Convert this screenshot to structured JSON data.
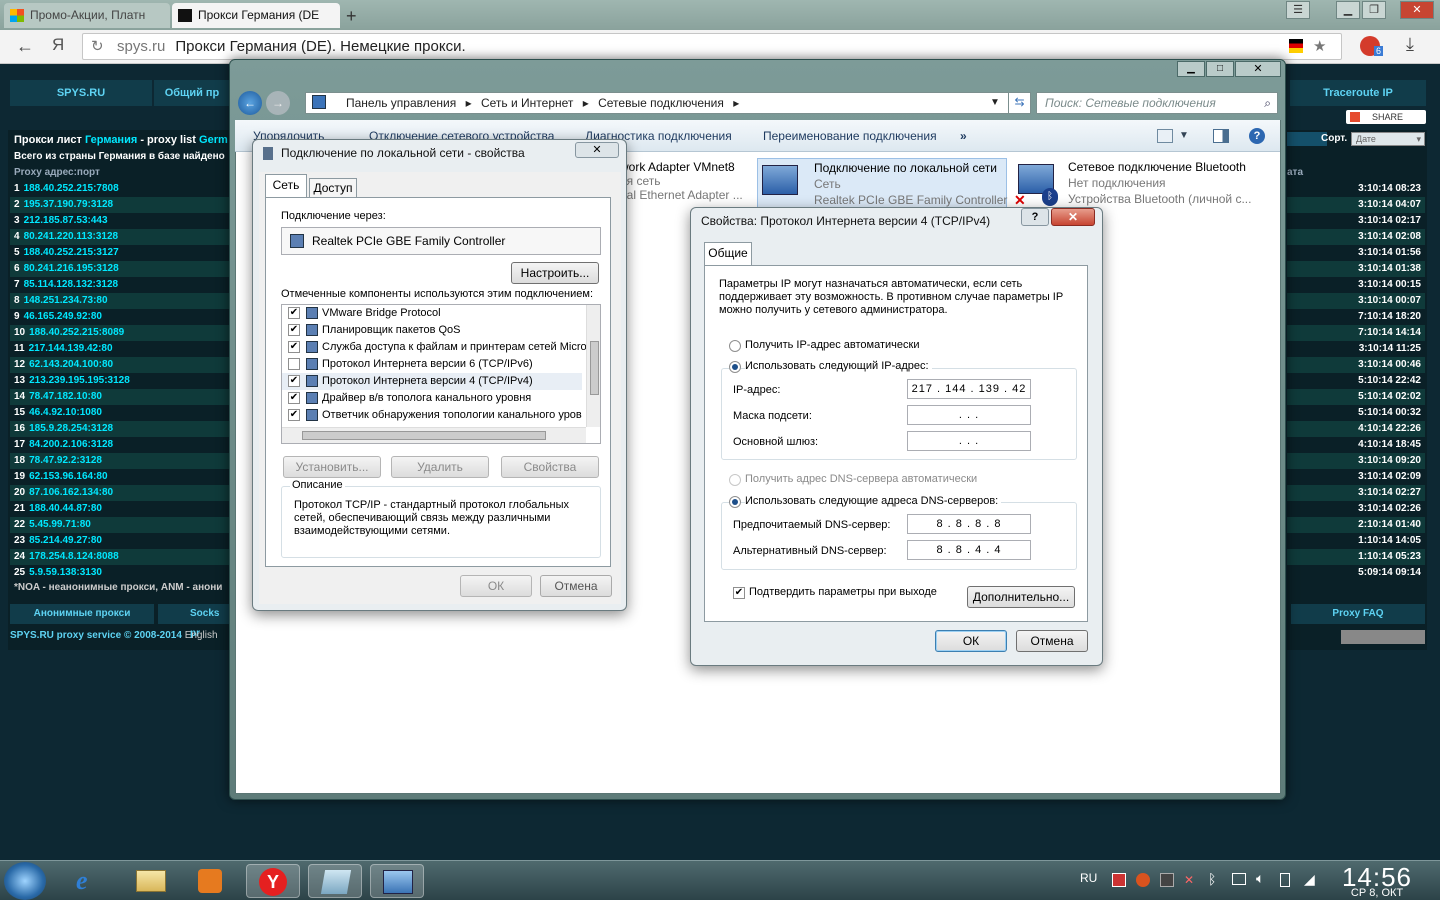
{
  "browser": {
    "tabs": [
      {
        "label": "Промо-Акции, Платн"
      },
      {
        "label": "Прокси Германия (DE"
      }
    ],
    "url_domain": "spys.ru",
    "url_title": "Прокси Германия (DE). Немецкие прокси.",
    "yandex_badge": "6"
  },
  "spys": {
    "nav": [
      "SPYS.RU",
      "Общий пр",
      "Traceroute IP"
    ],
    "share": "SHARE",
    "sort_label": "Сорт.",
    "sort_value": "Дате",
    "list_title": "Прокси лист ",
    "list_title_country": "Германия",
    "list_title_rest": " - proxy list ",
    "list_title_en": "Germ",
    "total": "Всего из страны Германия в базе найдено",
    "col_addr": "Proxy адрес:порт",
    "col_date": "ата",
    "rows": [
      {
        "n": "1",
        "ip": "188.40.252.215:7808",
        "t": "3:10:14 08:23"
      },
      {
        "n": "2",
        "ip": "195.37.190.79:3128",
        "t": "3:10:14 04:07"
      },
      {
        "n": "3",
        "ip": "212.185.87.53:443",
        "t": "3:10:14 02:17"
      },
      {
        "n": "4",
        "ip": "80.241.220.113:3128",
        "t": "3:10:14 02:08"
      },
      {
        "n": "5",
        "ip": "188.40.252.215:3127",
        "t": "3:10:14 01:56"
      },
      {
        "n": "6",
        "ip": "80.241.216.195:3128",
        "t": "3:10:14 01:38"
      },
      {
        "n": "7",
        "ip": "85.114.128.132:3128",
        "t": "3:10:14 00:15"
      },
      {
        "n": "8",
        "ip": "148.251.234.73:80",
        "t": "3:10:14 00:07"
      },
      {
        "n": "9",
        "ip": "46.165.249.92:80",
        "t": "7:10:14 18:20"
      },
      {
        "n": "10",
        "ip": "188.40.252.215:8089",
        "t": "7:10:14 14:14"
      },
      {
        "n": "11",
        "ip": "217.144.139.42:80",
        "t": "3:10:14 11:25"
      },
      {
        "n": "12",
        "ip": "62.143.204.100:80",
        "t": "3:10:14 00:46"
      },
      {
        "n": "13",
        "ip": "213.239.195.195:3128",
        "t": "5:10:14 22:42"
      },
      {
        "n": "14",
        "ip": "78.47.182.10:80",
        "t": "5:10:14 02:02"
      },
      {
        "n": "15",
        "ip": "46.4.92.10:1080",
        "t": "5:10:14 00:32"
      },
      {
        "n": "16",
        "ip": "185.9.28.254:3128",
        "t": "4:10:14 22:26"
      },
      {
        "n": "17",
        "ip": "84.200.2.106:3128",
        "t": "4:10:14 18:45"
      },
      {
        "n": "18",
        "ip": "78.47.92.2:3128",
        "t": "3:10:14 09:20"
      },
      {
        "n": "19",
        "ip": "62.153.96.164:80",
        "t": "3:10:14 02:09"
      },
      {
        "n": "20",
        "ip": "87.106.162.134:80",
        "t": "3:10:14 02:27"
      },
      {
        "n": "21",
        "ip": "188.40.44.87:80",
        "t": "3:10:14 02:26"
      },
      {
        "n": "22",
        "ip": "5.45.99.71:80",
        "t": "2:10:14 01:40"
      },
      {
        "n": "23",
        "ip": "85.214.49.27:80",
        "t": "1:10:14 14:05"
      },
      {
        "n": "24",
        "ip": "178.254.8.124:8088",
        "t": "1:10:14 05:23"
      },
      {
        "n": "25",
        "ip": "5.9.59.138:3130",
        "t": "5:09:14 09:14"
      }
    ],
    "noa": "*NOA - неанонимные прокси, ANM - анони",
    "bottom_links": [
      "Анонимные прокси",
      "Socks pr",
      "Proxy FAQ"
    ],
    "footer": "SPYS.RU proxy service © 2008-2014",
    "footer_lang": "English"
  },
  "explorer": {
    "breadcrumb": [
      "Панель управления",
      "Сетевые подключения",
      "Сеть и Интернет"
    ],
    "search_placeholder": "Поиск: Сетевые подключения",
    "commands": [
      "Упорядочить",
      "Отключение сетевого устройства",
      "Диагностика подключения",
      "Переименование подключения",
      "»"
    ],
    "adapters": [
      {
        "name": "work Adapter VMnet8",
        "status": "ая сеть",
        "device": "ual Ethernet Adapter ..."
      },
      {
        "name": "Подключение по локальной сети",
        "status": "Сеть",
        "device": "Realtek PCIe GBE Family Controller"
      },
      {
        "name": "Сетевое подключение Bluetooth",
        "status": "Нет подключения",
        "device": "Устройства Bluetooth (личной с..."
      }
    ]
  },
  "lan_dialog": {
    "title": "Подключение по локальной сети - свойства",
    "tabs": [
      "Сеть",
      "Доступ"
    ],
    "connect_via": "Подключение через:",
    "adapter": "Realtek PCIe GBE Family Controller",
    "configure": "Настроить...",
    "components_label": "Отмеченные компоненты используются этим подключением:",
    "components": [
      {
        "label": "VMware Bridge Protocol",
        "checked": "✔"
      },
      {
        "label": "Планировщик пакетов QoS",
        "checked": "✔"
      },
      {
        "label": "Служба доступа к файлам и принтерам сетей Micro",
        "checked": "✔"
      },
      {
        "label": "Протокол Интернета версии 6 (TCP/IPv6)",
        "checked": ""
      },
      {
        "label": "Протокол Интернета версии 4 (TCP/IPv4)",
        "checked": "✔"
      },
      {
        "label": "Драйвер в/в тополога канального уровня",
        "checked": "✔"
      },
      {
        "label": "Ответчик обнаружения топологии канального уров",
        "checked": "✔"
      }
    ],
    "install": "Установить...",
    "remove": "Удалить",
    "properties": "Свойства",
    "desc_title": "Описание",
    "desc": "Протокол TCP/IP - стандартный протокол глобальных сетей, обеспечивающий связь между различными взаимодействующими сетями.",
    "ok": "ОК",
    "cancel": "Отмена"
  },
  "ipv4_dialog": {
    "title": "Свойства: Протокол Интернета версии 4 (TCP/IPv4)",
    "tab": "Общие",
    "intro": "Параметры IP могут назначаться автоматически, если сеть поддерживает эту возможность. В противном случае параметры IP можно получить у сетевого администратора.",
    "auto_ip": "Получить IP-адрес автоматически",
    "manual_ip": "Использовать следующий IP-адрес:",
    "ip_label": "IP-адрес:",
    "ip_value": "217 . 144 . 139 . 42",
    "mask_label": "Маска подсети:",
    "mask_value": ".      .      .",
    "gw_label": "Основной шлюз:",
    "gw_value": ".      .      .",
    "auto_dns": "Получить адрес DNS-сервера автоматически",
    "manual_dns": "Использовать следующие адреса DNS-серверов:",
    "pref_dns_label": "Предпочитаемый DNS-сервер:",
    "pref_dns": "8  .  8  .  8  .  8",
    "alt_dns_label": "Альтернативный DNS-сервер:",
    "alt_dns": "8  .  8  .  4  .  4",
    "validate": "Подтвердить параметры при выходе",
    "advanced": "Дополнительно...",
    "ok": "ОК",
    "cancel": "Отмена"
  },
  "taskbar": {
    "lang": "RU",
    "time": "14:56",
    "date": "СР  8, ОКТ"
  }
}
